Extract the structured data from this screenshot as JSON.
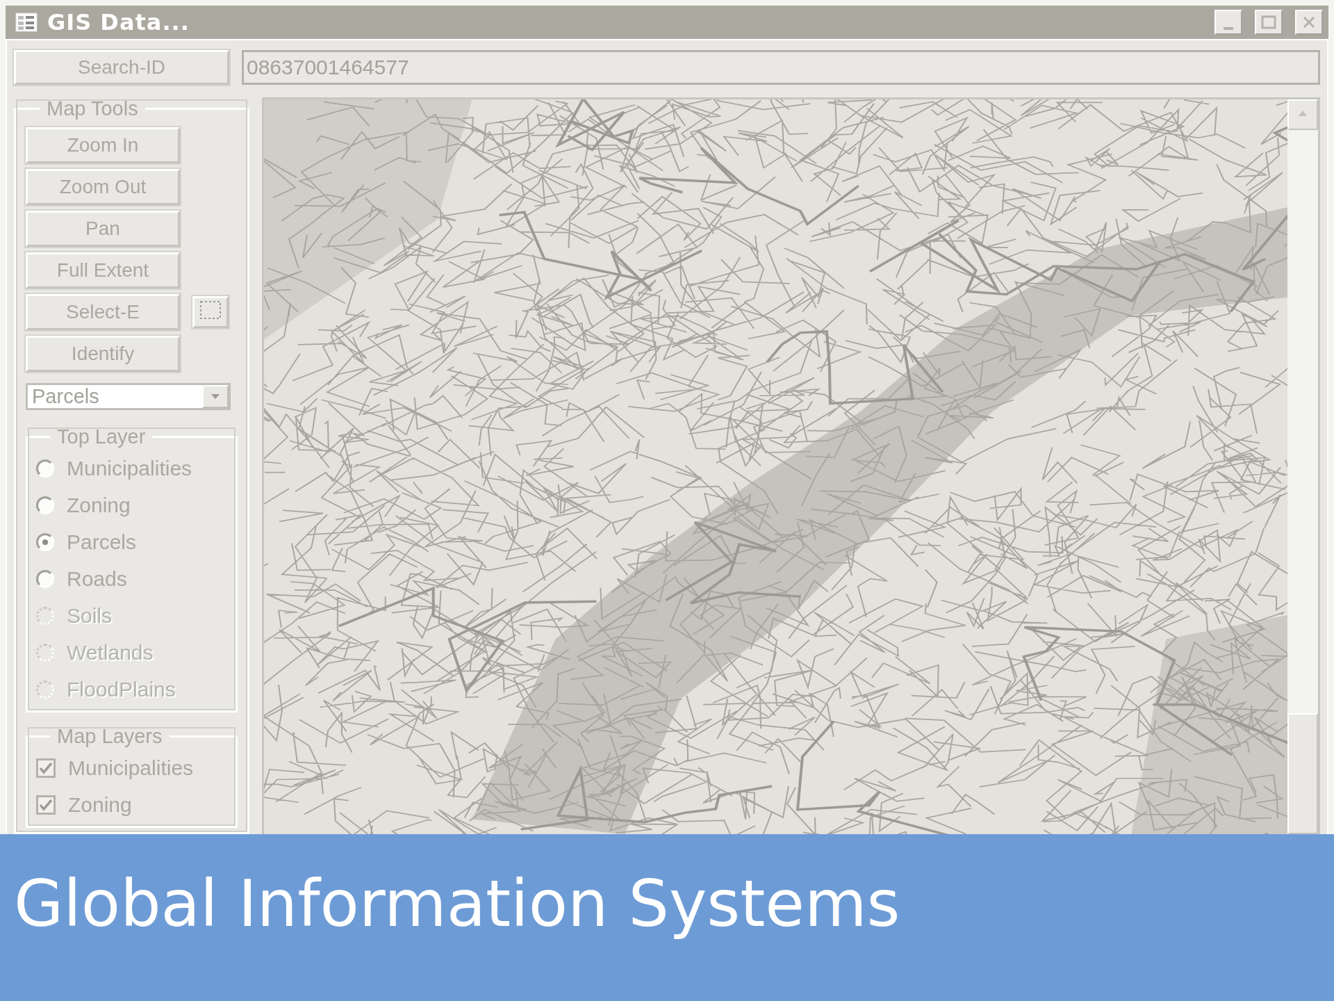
{
  "window": {
    "title": "GIS Data..."
  },
  "search": {
    "button": "Search-ID",
    "value": "08637001464577"
  },
  "map_tools": {
    "title": "Map Tools",
    "buttons": [
      {
        "label": "Zoom In",
        "kind": "plain"
      },
      {
        "label": "Zoom Out",
        "kind": "plain"
      },
      {
        "label": "Pan",
        "kind": "plain"
      },
      {
        "label": "Full Extent",
        "kind": "plain"
      },
      {
        "label": "Select-E",
        "kind": "with-icon"
      },
      {
        "label": "Identify",
        "kind": "plain"
      }
    ],
    "layer_select": {
      "value": "Parcels"
    }
  },
  "top_layer": {
    "title": "Top Layer",
    "options": [
      {
        "label": "Municipalities",
        "selected": false,
        "disabled": false
      },
      {
        "label": "Zoning",
        "selected": false,
        "disabled": false
      },
      {
        "label": "Parcels",
        "selected": true,
        "disabled": false
      },
      {
        "label": "Roads",
        "selected": false,
        "disabled": false
      },
      {
        "label": "Soils",
        "selected": false,
        "disabled": true
      },
      {
        "label": "Wetlands",
        "selected": false,
        "disabled": true
      },
      {
        "label": "FloodPlains",
        "selected": false,
        "disabled": true
      }
    ]
  },
  "map_layers": {
    "title": "Map Layers",
    "items": [
      {
        "label": "Municipalities",
        "checked": true
      },
      {
        "label": "Zoning",
        "checked": true
      }
    ]
  },
  "banner": {
    "title": "Global Information Systems"
  }
}
